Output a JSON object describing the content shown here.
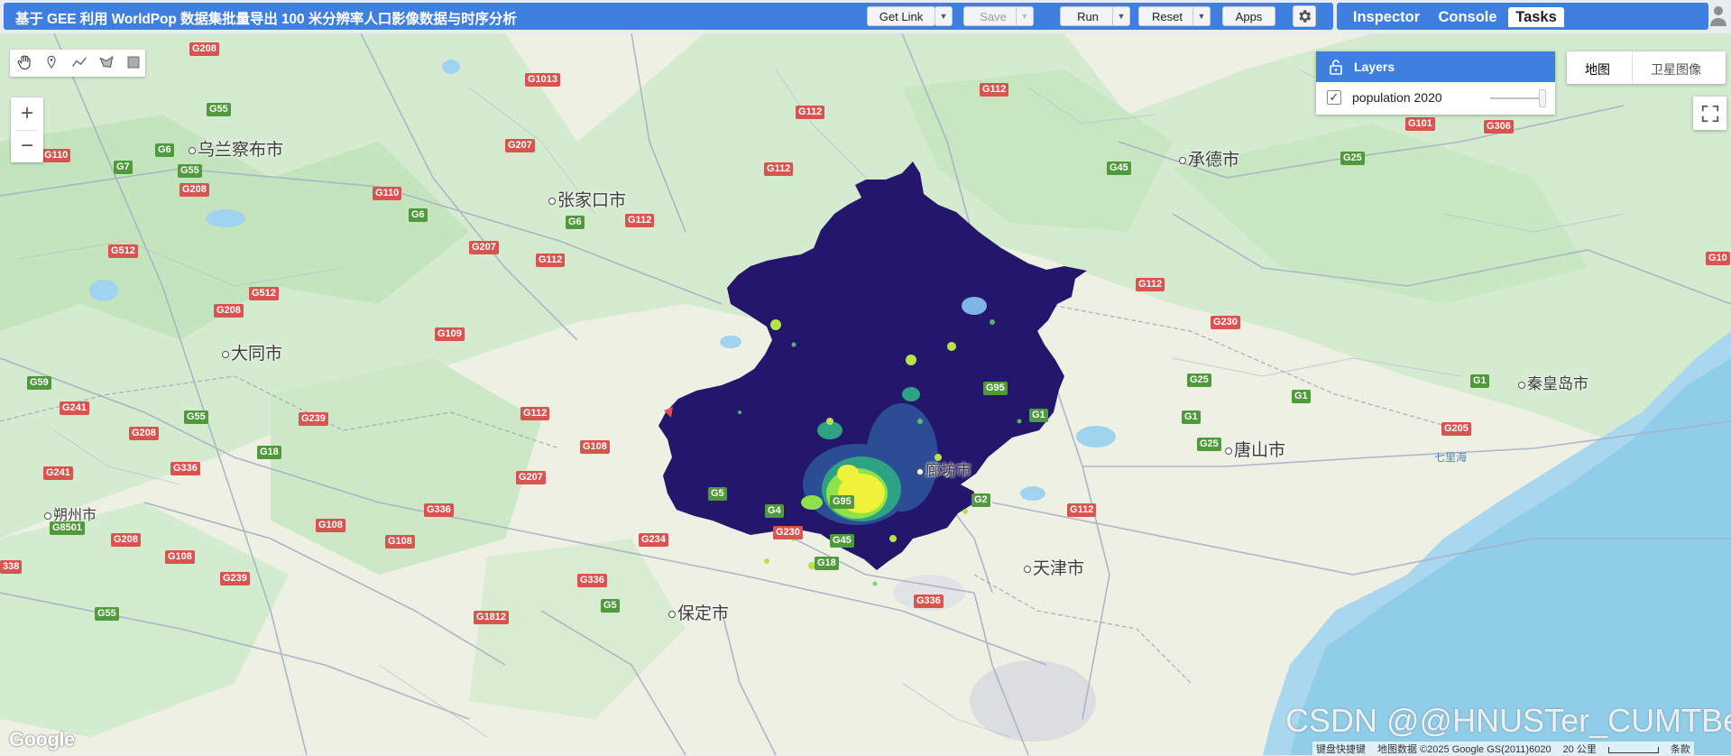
{
  "header": {
    "title": "基于 GEE 利用 WorldPop 数据集批量导出 100 米分辨率人口影像数据与时序分析",
    "get_link": "Get Link",
    "save": "Save",
    "run": "Run",
    "reset": "Reset",
    "apps": "Apps"
  },
  "tabs": [
    {
      "label": "Inspector"
    },
    {
      "label": "Console"
    },
    {
      "label": "Tasks"
    }
  ],
  "layers_panel": {
    "title": "Layers",
    "layer_name": "population 2020"
  },
  "map_type": {
    "map": "地图",
    "satellite": "卫星图像"
  },
  "cities": [
    {
      "name": "乌兰察布市"
    },
    {
      "name": "张家口市"
    },
    {
      "name": "承德市"
    },
    {
      "name": "大同市"
    },
    {
      "name": "秦皇岛市"
    },
    {
      "name": "唐山市"
    },
    {
      "name": "廊坊市"
    },
    {
      "name": "天津市"
    },
    {
      "name": "朔州市"
    },
    {
      "name": "保定市"
    }
  ],
  "water_label": "七里海",
  "attribution": {
    "shortcuts": "键盘快捷键",
    "data": "地图数据 ©2025 Google GS(2011)6020",
    "scale": "20 公里",
    "terms": "条款"
  },
  "google_logo": "Google",
  "watermark": "CSDN @@HNUSTer_CUMTBer",
  "icons": [
    "hand-icon",
    "marker-icon",
    "line-icon",
    "polygon-icon",
    "rectangle-icon",
    "settings-icon",
    "lock-icon",
    "fullscreen-icon",
    "person-icon"
  ]
}
